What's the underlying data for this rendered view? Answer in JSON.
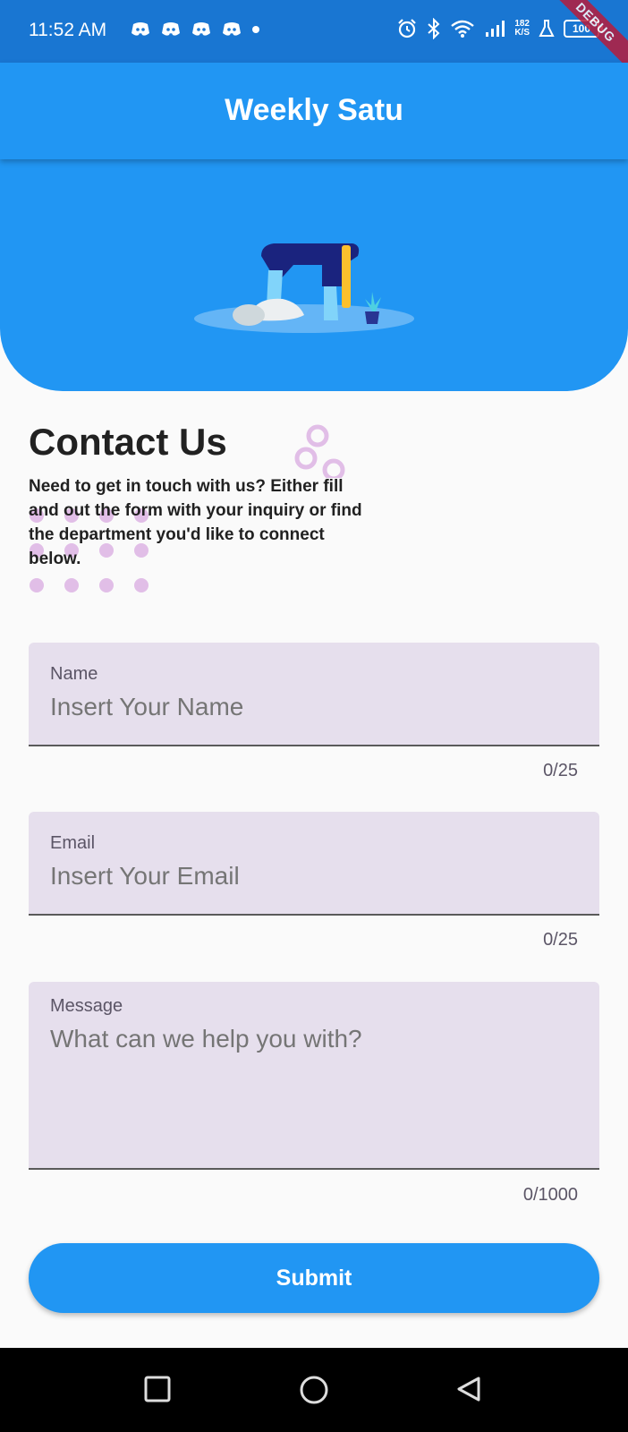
{
  "status_bar": {
    "time": "11:52 AM",
    "speed_top": "182",
    "speed_bottom": "K/S",
    "battery": "100",
    "debug_label": "DEBUG"
  },
  "app_bar": {
    "title": "Weekly Satu"
  },
  "contact": {
    "title": "Contact Us",
    "description": "Need to get in touch with us? Either fill and out the form with your inquiry or find the department you'd like to connect below."
  },
  "form": {
    "name": {
      "label": "Name",
      "placeholder": "Insert Your Name",
      "counter": "0/25"
    },
    "email": {
      "label": "Email",
      "placeholder": "Insert Your Email",
      "counter": "0/25"
    },
    "message": {
      "label": "Message",
      "placeholder": "What can we help you with?",
      "counter": "0/1000"
    },
    "submit_label": "Submit"
  },
  "colors": {
    "primary": "#2196f3",
    "status_bar": "#1976d2",
    "field_bg": "#e6dfed",
    "accent_deco": "#e1bee7"
  },
  "icons": {
    "notifications": [
      "discord-icon",
      "discord-icon",
      "discord-icon",
      "discord-icon"
    ],
    "status": [
      "alarm-icon",
      "bluetooth-icon",
      "wifi-icon",
      "signal-icon",
      "lab-icon",
      "battery-icon"
    ],
    "nav": [
      "recents-icon",
      "home-icon",
      "back-icon"
    ]
  }
}
